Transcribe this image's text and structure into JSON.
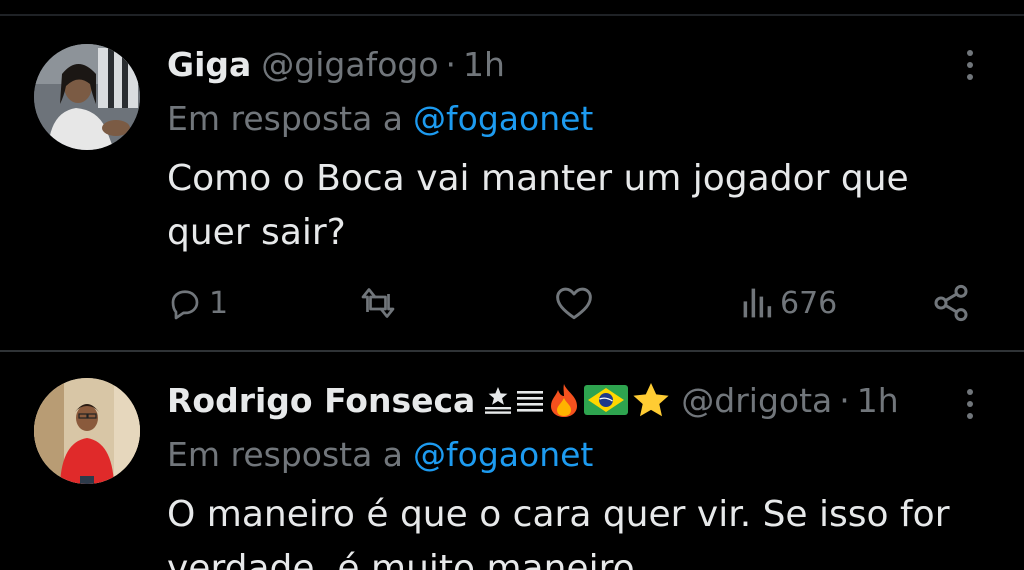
{
  "tweets": [
    {
      "display_name": "Giga",
      "handle": "@gigafogo",
      "separator": "·",
      "time": "1h",
      "reply_prefix": "Em resposta a",
      "reply_handle": "@fogaonet",
      "text": "Como o Boca vai manter um jogador que quer sair?",
      "reply_count": "1",
      "views": "676",
      "avatar_icon": "profile-photo-man-long-hair"
    },
    {
      "display_name": "Rodrigo Fonseca",
      "badges": [
        "botafogo-star-icon",
        "fire-emoji",
        "brazil-flag-emoji",
        "star-emoji"
      ],
      "handle": "@drigota",
      "separator": "·",
      "time": "1h",
      "reply_prefix": "Em resposta a",
      "reply_handle": "@fogaonet",
      "text": "O maneiro é que o cara quer vir. Se isso for verdade, é muito maneiro.",
      "avatar_icon": "profile-photo-man-red-shirt"
    }
  ],
  "colors": {
    "background": "#000000",
    "primary_text": "#e7e9ea",
    "secondary_text": "#71767b",
    "link": "#1d9bf0",
    "divider": "#2f3336"
  }
}
